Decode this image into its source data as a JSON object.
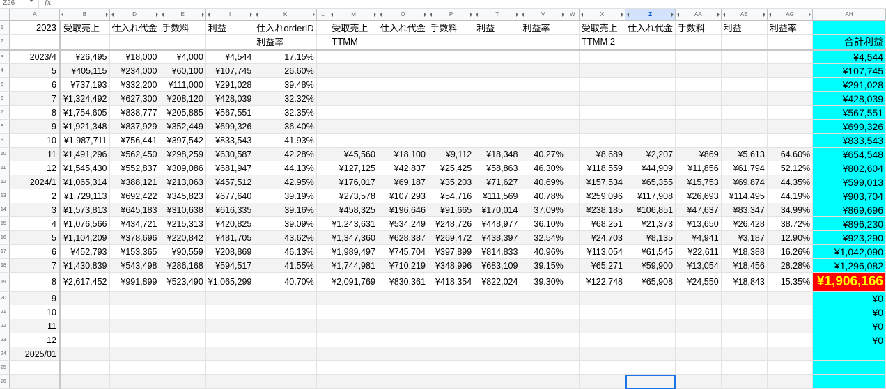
{
  "formula_bar": {
    "cell_ref": "Z26",
    "fx_symbol": "fx",
    "formula": ""
  },
  "columns": [
    "A",
    "B",
    "D",
    "E",
    "I",
    "K",
    "L",
    "M",
    "O",
    "P",
    "T",
    "V",
    "W",
    "X",
    "Z",
    "AA",
    "AE",
    "AG",
    "AH"
  ],
  "selected_column": "Z",
  "header": {
    "year": "2023",
    "g1": {
      "sales": "受取売上",
      "purchase": "仕入れ代金",
      "fee": "手数料",
      "profit": "利益",
      "order_id": "仕入れorderID",
      "rate": "利益率"
    },
    "g2": {
      "sales": "受取売上",
      "purchase": "仕入れ代金",
      "fee": "手数料",
      "profit": "利益",
      "rate": "利益率",
      "name": "TTMM"
    },
    "g3": {
      "sales": "受取売上",
      "purchase": "仕入れ代金",
      "fee": "手数料",
      "profit": "利益",
      "rate": "利益率",
      "name": "TTMM 2"
    },
    "total": "合計利益"
  },
  "rows": [
    {
      "r": "3",
      "m": "2023/4",
      "v": [
        "¥26,495",
        "¥18,000",
        "¥4,000",
        "¥4,544",
        "17.15%",
        "",
        "",
        "",
        "",
        "",
        "",
        "",
        "",
        "",
        "",
        ""
      ],
      "t": "¥4,544"
    },
    {
      "r": "4",
      "m": "5",
      "v": [
        "¥405,115",
        "¥234,000",
        "¥60,100",
        "¥107,745",
        "26.60%",
        "",
        "",
        "",
        "",
        "",
        "",
        "",
        "",
        "",
        "",
        ""
      ],
      "t": "¥107,745"
    },
    {
      "r": "5",
      "m": "6",
      "v": [
        "¥737,193",
        "¥332,200",
        "¥111,000",
        "¥291,028",
        "39.48%",
        "",
        "",
        "",
        "",
        "",
        "",
        "",
        "",
        "",
        "",
        ""
      ],
      "t": "¥291,028"
    },
    {
      "r": "6",
      "m": "7",
      "v": [
        "¥1,324,492",
        "¥627,300",
        "¥208,120",
        "¥428,039",
        "32.32%",
        "",
        "",
        "",
        "",
        "",
        "",
        "",
        "",
        "",
        "",
        ""
      ],
      "t": "¥428,039"
    },
    {
      "r": "7",
      "m": "8",
      "v": [
        "¥1,754,605",
        "¥838,777",
        "¥205,885",
        "¥567,551",
        "32.35%",
        "",
        "",
        "",
        "",
        "",
        "",
        "",
        "",
        "",
        "",
        ""
      ],
      "t": "¥567,551"
    },
    {
      "r": "8",
      "m": "9",
      "v": [
        "¥1,921,348",
        "¥837,929",
        "¥352,449",
        "¥699,326",
        "36.40%",
        "",
        "",
        "",
        "",
        "",
        "",
        "",
        "",
        "",
        "",
        ""
      ],
      "t": "¥699,326"
    },
    {
      "r": "9",
      "m": "10",
      "v": [
        "¥1,987,711",
        "¥756,441",
        "¥397,542",
        "¥833,543",
        "41.93%",
        "",
        "",
        "",
        "",
        "",
        "",
        "",
        "",
        "",
        "",
        ""
      ],
      "t": "¥833,543"
    },
    {
      "r": "10",
      "m": "11",
      "v": [
        "¥1,491,296",
        "¥562,450",
        "¥298,259",
        "¥630,587",
        "42.28%",
        "¥45,560",
        "¥18,100",
        "¥9,112",
        "¥18,348",
        "40.27%",
        "¥8,689",
        "¥2,207",
        "¥869",
        "¥5,613",
        "64.60%"
      ],
      "t": "¥654,548"
    },
    {
      "r": "11",
      "m": "12",
      "v": [
        "¥1,545,430",
        "¥552,837",
        "¥309,086",
        "¥681,947",
        "44.13%",
        "¥127,125",
        "¥42,837",
        "¥25,425",
        "¥58,863",
        "46.30%",
        "¥118,559",
        "¥44,909",
        "¥11,856",
        "¥61,794",
        "52.12%"
      ],
      "t": "¥802,604"
    },
    {
      "r": "12",
      "m": "2024/1",
      "v": [
        "¥1,065,314",
        "¥388,121",
        "¥213,063",
        "¥457,512",
        "42.95%",
        "¥176,017",
        "¥69,187",
        "¥35,203",
        "¥71,627",
        "40.69%",
        "¥157,534",
        "¥65,355",
        "¥15,753",
        "¥69,874",
        "44.35%"
      ],
      "t": "¥599,013"
    },
    {
      "r": "13",
      "m": "2",
      "v": [
        "¥1,729,113",
        "¥692,422",
        "¥345,823",
        "¥677,640",
        "39.19%",
        "¥273,578",
        "¥107,293",
        "¥54,716",
        "¥111,569",
        "40.78%",
        "¥259,096",
        "¥117,908",
        "¥26,693",
        "¥114,495",
        "44.19%"
      ],
      "t": "¥903,704"
    },
    {
      "r": "14",
      "m": "3",
      "v": [
        "¥1,573,813",
        "¥645,183",
        "¥310,638",
        "¥616,335",
        "39.16%",
        "¥458,325",
        "¥196,646",
        "¥91,665",
        "¥170,014",
        "37.09%",
        "¥238,185",
        "¥106,851",
        "¥47,637",
        "¥83,347",
        "34.99%"
      ],
      "t": "¥869,696"
    },
    {
      "r": "15",
      "m": "4",
      "v": [
        "¥1,076,566",
        "¥434,721",
        "¥215,313",
        "¥420,825",
        "39.09%",
        "¥1,243,631",
        "¥534,249",
        "¥248,726",
        "¥448,977",
        "36.10%",
        "¥68,251",
        "¥21,373",
        "¥13,650",
        "¥26,428",
        "38.72%"
      ],
      "t": "¥896,230"
    },
    {
      "r": "16",
      "m": "5",
      "v": [
        "¥1,104,209",
        "¥378,696",
        "¥220,842",
        "¥481,705",
        "43.62%",
        "¥1,347,360",
        "¥628,387",
        "¥269,472",
        "¥438,397",
        "32.54%",
        "¥24,703",
        "¥8,135",
        "¥4,941",
        "¥3,187",
        "12.90%"
      ],
      "t": "¥923,290"
    },
    {
      "r": "17",
      "m": "6",
      "v": [
        "¥452,793",
        "¥153,365",
        "¥90,559",
        "¥208,869",
        "46.13%",
        "¥1,989,497",
        "¥745,704",
        "¥397,899",
        "¥814,833",
        "40.96%",
        "¥113,054",
        "¥61,545",
        "¥22,611",
        "¥18,388",
        "16.26%"
      ],
      "t": "¥1,042,090"
    },
    {
      "r": "18",
      "m": "7",
      "v": [
        "¥1,430,839",
        "¥543,498",
        "¥286,168",
        "¥594,517",
        "41.55%",
        "¥1,744,981",
        "¥710,219",
        "¥348,996",
        "¥683,109",
        "39.15%",
        "¥65,271",
        "¥59,900",
        "¥13,054",
        "¥18,456",
        "28.28%"
      ],
      "t": "¥1,296,082"
    },
    {
      "r": "19",
      "m": "8",
      "v": [
        "¥2,617,452",
        "¥991,899",
        "¥523,490",
        "¥1,065,299",
        "40.70%",
        "¥2,091,769",
        "¥830,361",
        "¥418,354",
        "¥822,024",
        "39.30%",
        "¥122,748",
        "¥65,908",
        "¥24,550",
        "¥18,843",
        "15.35%"
      ],
      "t": "¥1,906,166",
      "highlight": true
    },
    {
      "r": "20",
      "m": "9",
      "v": [],
      "t": "¥0"
    },
    {
      "r": "21",
      "m": "10",
      "v": [],
      "t": "¥0"
    },
    {
      "r": "22",
      "m": "11",
      "v": [],
      "t": "¥0"
    },
    {
      "r": "23",
      "m": "12",
      "v": [],
      "t": "¥0"
    },
    {
      "r": "24",
      "m": "2025/01",
      "v": [],
      "t": ""
    },
    {
      "r": "25",
      "m": "",
      "v": [],
      "t": ""
    },
    {
      "r": "26",
      "m": "",
      "v": [],
      "t": ""
    }
  ],
  "colors": {
    "total_bg": "#00ffff",
    "highlight_bg": "#ff0000",
    "highlight_text": "#ffff00",
    "selection": "#1a73e8"
  }
}
